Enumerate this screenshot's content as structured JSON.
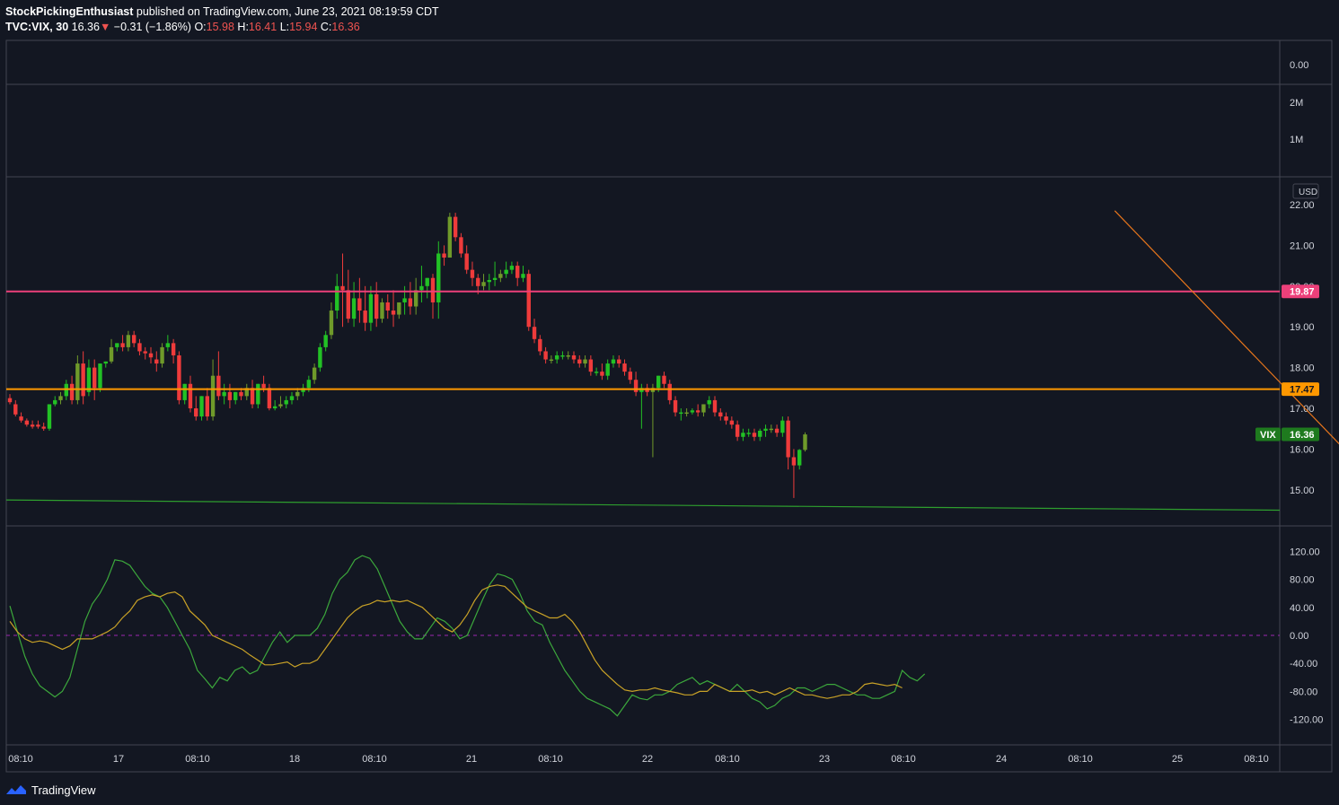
{
  "header": {
    "author": "StockPickingEnthusiast",
    "published_text": "published on TradingView.com, June 23, 2021 08:19:59 CDT",
    "symbol": "TVC:VIX, 30",
    "last": "16.36",
    "change_arrow": "▼",
    "change": "−0.31 (−1.86%)",
    "open_label": "O:",
    "open": "15.98",
    "high_label": "H:",
    "high": "16.41",
    "low_label": "L:",
    "low": "15.94",
    "close_label": "C:",
    "close": "16.36"
  },
  "footer": {
    "brand": "TradingView",
    "icon": "tradingview-logo-icon"
  },
  "colors": {
    "background": "#131722",
    "up": "#26a69a",
    "bull": "#22c125",
    "bear": "#ef3b3b",
    "bull_alt": "#6f9a2a",
    "pink_line": "#ec407a",
    "orange_line": "#ff9800",
    "trend_line": "#e8761c",
    "support_line": "#2e9e2e",
    "osc_green": "#3ca83c",
    "osc_yellow": "#c9a227",
    "grid_border": "#434651",
    "zero_line": "#9c27b0"
  },
  "panes": {
    "top": {
      "ticks": [
        "0.00"
      ]
    },
    "volume": {
      "ticks": [
        "2M",
        "1M"
      ]
    },
    "price": {
      "currency": "USD",
      "ticks": [
        "22.00",
        "21.00",
        "20.00",
        "19.00",
        "18.00",
        "17.00",
        "16.00",
        "15.00"
      ]
    },
    "osc": {
      "ticks": [
        "120.00",
        "80.00",
        "40.00",
        "0.00",
        "-40.00",
        "-80.00",
        "-120.00"
      ]
    }
  },
  "time_axis": [
    "08:10",
    "17",
    "08:10",
    "18",
    "08:10",
    "21",
    "08:10",
    "22",
    "08:10",
    "23",
    "08:10",
    "24",
    "08:10",
    "25",
    "08:10"
  ],
  "labels": {
    "pink_level": "19.87",
    "orange_level": "17.47",
    "vix_tag": "VIX",
    "vix_price": "16.36"
  },
  "chart_data": [
    {
      "type": "candlestick",
      "symbol": "TVC:VIX",
      "interval": "30",
      "ylim": [
        14.6,
        22.4
      ],
      "horizontal_levels": [
        19.87,
        17.47
      ],
      "trendline": {
        "from": [
          22.2,
          21.85
        ],
        "to": [
          23.8,
          14.65
        ]
      },
      "support_line": {
        "from": [
          16.0,
          14.75
        ],
        "to": [
          25.3,
          14.5
        ]
      },
      "candles": [
        [
          17.25,
          17.35,
          17.15,
          17.1
        ],
        [
          17.1,
          17.2,
          16.85,
          16.8
        ],
        [
          16.8,
          16.9,
          16.7,
          16.65
        ],
        [
          16.7,
          16.75,
          16.6,
          16.55
        ],
        [
          16.6,
          16.7,
          16.55,
          16.5
        ],
        [
          16.6,
          16.7,
          16.55,
          16.5
        ],
        [
          16.55,
          16.65,
          16.5,
          16.45
        ],
        [
          16.5,
          16.9,
          17.1,
          16.45
        ],
        [
          17.1,
          17.3,
          17.2,
          17.05
        ],
        [
          17.2,
          17.4,
          17.3,
          17.1
        ],
        [
          17.3,
          17.7,
          17.6,
          17.2
        ],
        [
          17.6,
          17.8,
          17.2,
          17.1
        ],
        [
          17.2,
          18.3,
          18.1,
          17.1
        ],
        [
          18.1,
          18.4,
          17.3,
          17.1
        ],
        [
          17.4,
          18.2,
          18.0,
          17.3
        ],
        [
          18.0,
          18.2,
          17.5,
          17.2
        ],
        [
          17.5,
          18.1,
          18.1,
          17.4
        ],
        [
          18.1,
          18.1,
          18.15,
          18.0
        ],
        [
          18.15,
          18.7,
          18.5,
          18.1
        ],
        [
          18.5,
          18.6,
          18.6,
          18.4
        ],
        [
          18.6,
          18.8,
          18.5,
          18.4
        ],
        [
          18.5,
          18.9,
          18.8,
          18.4
        ],
        [
          18.8,
          18.9,
          18.6,
          18.5
        ],
        [
          18.6,
          18.7,
          18.4,
          18.3
        ],
        [
          18.4,
          18.5,
          18.35,
          18.2
        ],
        [
          18.35,
          18.5,
          18.25,
          18.1
        ],
        [
          18.2,
          18.4,
          18.1,
          17.9
        ],
        [
          18.1,
          18.6,
          18.5,
          18.0
        ],
        [
          18.5,
          18.8,
          18.6,
          18.4
        ],
        [
          18.6,
          18.7,
          18.3,
          18.1
        ],
        [
          18.3,
          18.4,
          17.2,
          17.1
        ],
        [
          17.2,
          17.5,
          17.6,
          17.1
        ],
        [
          17.6,
          17.8,
          17.0,
          16.9
        ],
        [
          17.0,
          17.3,
          16.8,
          16.7
        ],
        [
          16.8,
          17.2,
          17.3,
          16.7
        ],
        [
          17.3,
          17.5,
          16.8,
          16.7
        ],
        [
          16.8,
          18.2,
          17.8,
          16.7
        ],
        [
          17.8,
          18.4,
          17.3,
          17.2
        ],
        [
          17.3,
          17.6,
          17.4,
          17.1
        ],
        [
          17.4,
          17.6,
          17.2,
          17.0
        ],
        [
          17.2,
          17.4,
          17.4,
          17.1
        ],
        [
          17.4,
          17.5,
          17.3,
          17.2
        ],
        [
          17.3,
          17.6,
          17.5,
          17.2
        ],
        [
          17.5,
          17.7,
          17.1,
          17.0
        ],
        [
          17.1,
          17.6,
          17.6,
          17.0
        ],
        [
          17.6,
          17.8,
          17.5,
          17.4
        ],
        [
          17.5,
          17.6,
          17.0,
          16.95
        ],
        [
          17.0,
          17.2,
          17.05,
          16.95
        ],
        [
          17.05,
          17.3,
          17.1,
          17.0
        ],
        [
          17.1,
          17.3,
          17.2,
          17.0
        ],
        [
          17.2,
          17.4,
          17.3,
          17.1
        ],
        [
          17.3,
          17.5,
          17.4,
          17.2
        ],
        [
          17.4,
          17.6,
          17.5,
          17.3
        ],
        [
          17.5,
          17.8,
          17.7,
          17.4
        ],
        [
          17.7,
          18.1,
          18.0,
          17.6
        ],
        [
          18.0,
          18.6,
          18.5,
          17.9
        ],
        [
          18.5,
          18.9,
          18.8,
          18.4
        ],
        [
          18.8,
          19.6,
          19.4,
          18.7
        ],
        [
          19.4,
          20.3,
          20.0,
          19.2
        ],
        [
          20.0,
          20.8,
          19.9,
          19.0
        ],
        [
          19.9,
          20.4,
          19.2,
          19.1
        ],
        [
          19.2,
          20.1,
          19.7,
          19.0
        ],
        [
          19.7,
          20.2,
          19.4,
          19.1
        ],
        [
          19.4,
          20.0,
          19.1,
          18.9
        ],
        [
          19.1,
          20.0,
          19.8,
          18.9
        ],
        [
          19.8,
          20.1,
          19.2,
          19.0
        ],
        [
          19.2,
          19.7,
          19.6,
          19.1
        ],
        [
          19.6,
          19.8,
          19.4,
          19.2
        ],
        [
          19.4,
          19.9,
          19.3,
          19.0
        ],
        [
          19.3,
          19.6,
          19.6,
          19.2
        ],
        [
          19.6,
          20.0,
          19.7,
          19.3
        ],
        [
          19.7,
          20.1,
          19.5,
          19.3
        ],
        [
          19.5,
          20.2,
          19.9,
          19.3
        ],
        [
          19.9,
          20.5,
          20.0,
          19.6
        ],
        [
          20.0,
          20.2,
          20.2,
          19.7
        ],
        [
          20.2,
          20.3,
          19.6,
          19.2
        ],
        [
          19.6,
          21.1,
          20.8,
          19.2
        ],
        [
          20.8,
          21.0,
          20.7,
          20.5
        ],
        [
          20.7,
          21.8,
          21.7,
          20.7
        ],
        [
          21.7,
          21.8,
          21.2,
          21.1
        ],
        [
          21.2,
          21.3,
          20.8,
          20.7
        ],
        [
          20.8,
          21.0,
          20.4,
          20.3
        ],
        [
          20.4,
          20.6,
          20.2,
          20.0
        ],
        [
          20.2,
          20.3,
          20.0,
          19.8
        ],
        [
          20.0,
          20.3,
          20.1,
          19.9
        ],
        [
          20.1,
          20.3,
          20.15,
          19.9
        ],
        [
          20.15,
          20.6,
          20.2,
          20.0
        ],
        [
          20.2,
          20.4,
          20.3,
          20.1
        ],
        [
          20.3,
          20.6,
          20.4,
          20.2
        ],
        [
          20.4,
          20.6,
          20.5,
          20.3
        ],
        [
          20.5,
          20.6,
          20.2,
          20.0
        ],
        [
          20.2,
          20.5,
          20.3,
          20.1
        ],
        [
          20.3,
          20.4,
          19.0,
          18.9
        ],
        [
          19.0,
          19.2,
          18.7,
          18.6
        ],
        [
          18.7,
          18.8,
          18.4,
          18.3
        ],
        [
          18.4,
          18.5,
          18.2,
          18.1
        ],
        [
          18.2,
          18.3,
          18.2,
          18.1
        ],
        [
          18.2,
          18.4,
          18.3,
          18.1
        ],
        [
          18.3,
          18.4,
          18.3,
          18.2
        ],
        [
          18.3,
          18.4,
          18.3,
          18.2
        ],
        [
          18.3,
          18.4,
          18.2,
          18.1
        ],
        [
          18.2,
          18.3,
          18.1,
          18.0
        ],
        [
          18.1,
          18.3,
          18.2,
          18.0
        ],
        [
          18.2,
          18.3,
          17.9,
          17.8
        ],
        [
          17.9,
          18.0,
          17.9,
          17.8
        ],
        [
          17.9,
          18.1,
          17.8,
          17.7
        ],
        [
          17.8,
          18.2,
          18.1,
          17.7
        ],
        [
          18.1,
          18.3,
          18.2,
          18.0
        ],
        [
          18.2,
          18.3,
          18.1,
          18.0
        ],
        [
          18.1,
          18.2,
          17.9,
          17.8
        ],
        [
          17.9,
          18.0,
          17.7,
          17.6
        ],
        [
          17.7,
          17.9,
          17.4,
          17.3
        ],
        [
          17.4,
          17.6,
          17.5,
          16.5
        ],
        [
          17.5,
          17.6,
          17.4,
          17.3
        ],
        [
          17.4,
          17.6,
          17.5,
          15.8
        ],
        [
          17.5,
          17.8,
          17.8,
          17.4
        ],
        [
          17.8,
          17.9,
          17.6,
          17.5
        ],
        [
          17.6,
          17.7,
          17.2,
          17.1
        ],
        [
          17.2,
          17.3,
          16.9,
          16.8
        ],
        [
          16.9,
          17.0,
          16.9,
          16.7
        ],
        [
          16.9,
          17.0,
          16.9,
          16.8
        ],
        [
          16.9,
          17.0,
          16.95,
          16.85
        ],
        [
          16.95,
          17.1,
          16.9,
          16.8
        ],
        [
          16.9,
          17.1,
          17.1,
          16.8
        ],
        [
          17.1,
          17.3,
          17.2,
          17.0
        ],
        [
          17.2,
          17.3,
          16.9,
          16.8
        ],
        [
          16.9,
          17.0,
          16.8,
          16.7
        ],
        [
          16.8,
          16.9,
          16.7,
          16.6
        ],
        [
          16.7,
          16.8,
          16.6,
          16.5
        ],
        [
          16.6,
          16.7,
          16.3,
          16.2
        ],
        [
          16.3,
          16.5,
          16.4,
          16.2
        ],
        [
          16.4,
          16.5,
          16.4,
          16.3
        ],
        [
          16.4,
          16.5,
          16.3,
          16.2
        ],
        [
          16.3,
          16.5,
          16.45,
          16.2
        ],
        [
          16.45,
          16.6,
          16.5,
          16.3
        ],
        [
          16.5,
          16.6,
          16.5,
          16.4
        ],
        [
          16.5,
          16.6,
          16.4,
          16.3
        ],
        [
          16.4,
          16.8,
          16.7,
          16.3
        ],
        [
          16.7,
          16.8,
          15.8,
          15.5
        ],
        [
          15.8,
          16.0,
          15.6,
          14.8
        ],
        [
          15.6,
          16.0,
          15.98,
          15.5
        ],
        [
          15.98,
          16.41,
          16.36,
          15.94
        ]
      ],
      "oscillator": {
        "zero": 0,
        "ylim": [
          -145,
          140
        ],
        "fast_green": [
          42,
          5,
          -30,
          -55,
          -72,
          -80,
          -88,
          -80,
          -60,
          -20,
          20,
          45,
          60,
          80,
          108,
          106,
          100,
          85,
          70,
          60,
          55,
          40,
          20,
          0,
          -20,
          -50,
          -62,
          -75,
          -60,
          -65,
          -50,
          -45,
          -55,
          -50,
          -30,
          -10,
          5,
          -10,
          0,
          0,
          0,
          10,
          30,
          60,
          80,
          90,
          108,
          114,
          110,
          95,
          70,
          45,
          20,
          5,
          -5,
          -5,
          10,
          25,
          20,
          10,
          -5,
          0,
          25,
          50,
          73,
          88,
          85,
          80,
          60,
          35,
          20,
          15,
          -10,
          -30,
          -50,
          -65,
          -80,
          -90,
          -95,
          -100,
          -105,
          -115,
          -100,
          -85,
          -90,
          -92,
          -85,
          -85,
          -80,
          -70,
          -65,
          -60,
          -70,
          -65,
          -70,
          -75,
          -80,
          -70,
          -80,
          -90,
          -95,
          -105,
          -100,
          -90,
          -85,
          -75,
          -75,
          -80,
          -75,
          -70,
          -70,
          -75,
          -80,
          -85,
          -85,
          -90,
          -90,
          -85,
          -80,
          -50,
          -60,
          -65,
          -55
        ],
        "slow_yellow": [
          20,
          5,
          -5,
          -10,
          -8,
          -10,
          -15,
          -20,
          -15,
          -5,
          -5,
          -5,
          0,
          5,
          12,
          25,
          35,
          50,
          55,
          58,
          55,
          60,
          62,
          55,
          35,
          25,
          15,
          0,
          -5,
          -10,
          -15,
          -20,
          -28,
          -35,
          -42,
          -42,
          -40,
          -38,
          -45,
          -40,
          -40,
          -35,
          -20,
          -5,
          10,
          25,
          35,
          42,
          45,
          50,
          48,
          50,
          48,
          50,
          45,
          40,
          30,
          20,
          10,
          5,
          15,
          30,
          50,
          65,
          70,
          72,
          70,
          60,
          50,
          40,
          35,
          30,
          25,
          25,
          30,
          20,
          5,
          -15,
          -35,
          -50,
          -60,
          -70,
          -78,
          -80,
          -78,
          -78,
          -75,
          -78,
          -80,
          -82,
          -85,
          -85,
          -80,
          -80,
          -70,
          -75,
          -80,
          -80,
          -80,
          -78,
          -82,
          -80,
          -85,
          -80,
          -75,
          -80,
          -85,
          -85,
          -88,
          -90,
          -88,
          -85,
          -85,
          -80,
          -70,
          -68,
          -70,
          -72,
          -70,
          -75
        ]
      }
    }
  ]
}
